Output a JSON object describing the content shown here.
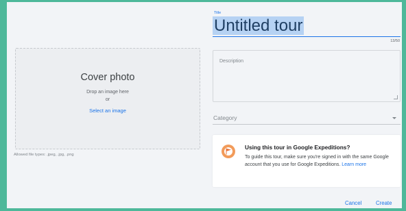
{
  "cover": {
    "title": "Cover photo",
    "drop_text": "Drop an image here",
    "or_text": "or",
    "select_label": "Select an image",
    "allowed_types": "Allowed file types: .jpeg, .jpg, .png"
  },
  "title_field": {
    "label": "Title",
    "value": "Untitled tour",
    "char_count": "13/50"
  },
  "description_field": {
    "placeholder": "Description"
  },
  "category_field": {
    "placeholder": "Category",
    "icon": "chevron-down-icon"
  },
  "expeditions_card": {
    "icon": "flag-icon",
    "title": "Using this tour in Google Expeditions?",
    "body": "To guide this tour, make sure you're signed in with the same Google account that you use for Google Expeditions.",
    "learn_more": "Learn more"
  },
  "actions": {
    "cancel_label": "Cancel",
    "create_label": "Create"
  },
  "colors": {
    "frame": "#4eb89a",
    "panel": "#f2f4f7",
    "accent": "#1a73e8",
    "title_highlight": "#b6d2f3",
    "icon_orange": "#f29b5a"
  }
}
